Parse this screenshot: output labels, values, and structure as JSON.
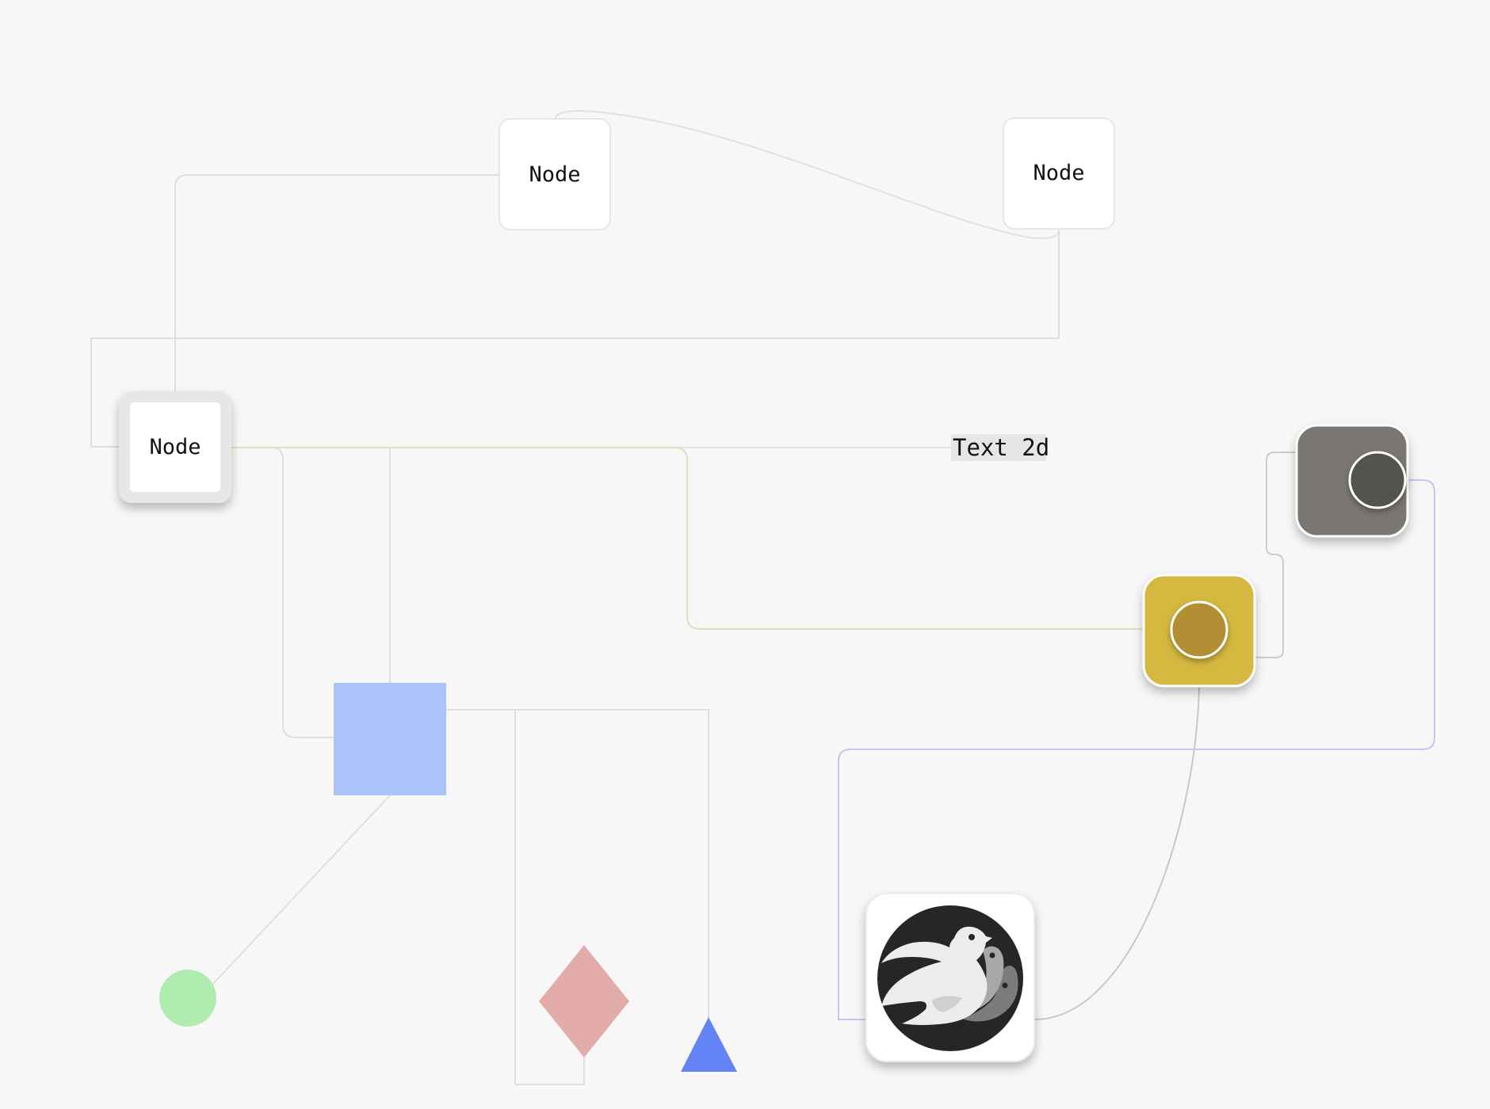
{
  "nodes": {
    "top_left_label": "Node",
    "top_right_label": "Node",
    "left_label": "Node"
  },
  "text2d": {
    "label": "Text 2d"
  },
  "colors": {
    "background": "#f7f7f7",
    "node_fill": "#ffffff",
    "node_border": "#e4e4e4",
    "edge_gray": "#dedede",
    "edge_tan": "#e6dcc0",
    "edge_blue": "#c3c8ef",
    "edge_dark": "#c8c8c8",
    "blue_square": "#aac4fb",
    "green_circle": "#b0ecb0",
    "pink_diamond": "#e3aca8",
    "blue_triangle": "#6483f5",
    "yellow_button": "#d4b840",
    "yellow_knob": "#b48e34",
    "gray_button": "#7a7772",
    "gray_knob": "#54524e",
    "logo_dark": "#262626",
    "logo_light": "#ececec",
    "logo_mid": "#a8a8a8",
    "logo_shade": "#7c7c7c"
  },
  "icons": {
    "logo": "bird-logo-icon"
  }
}
